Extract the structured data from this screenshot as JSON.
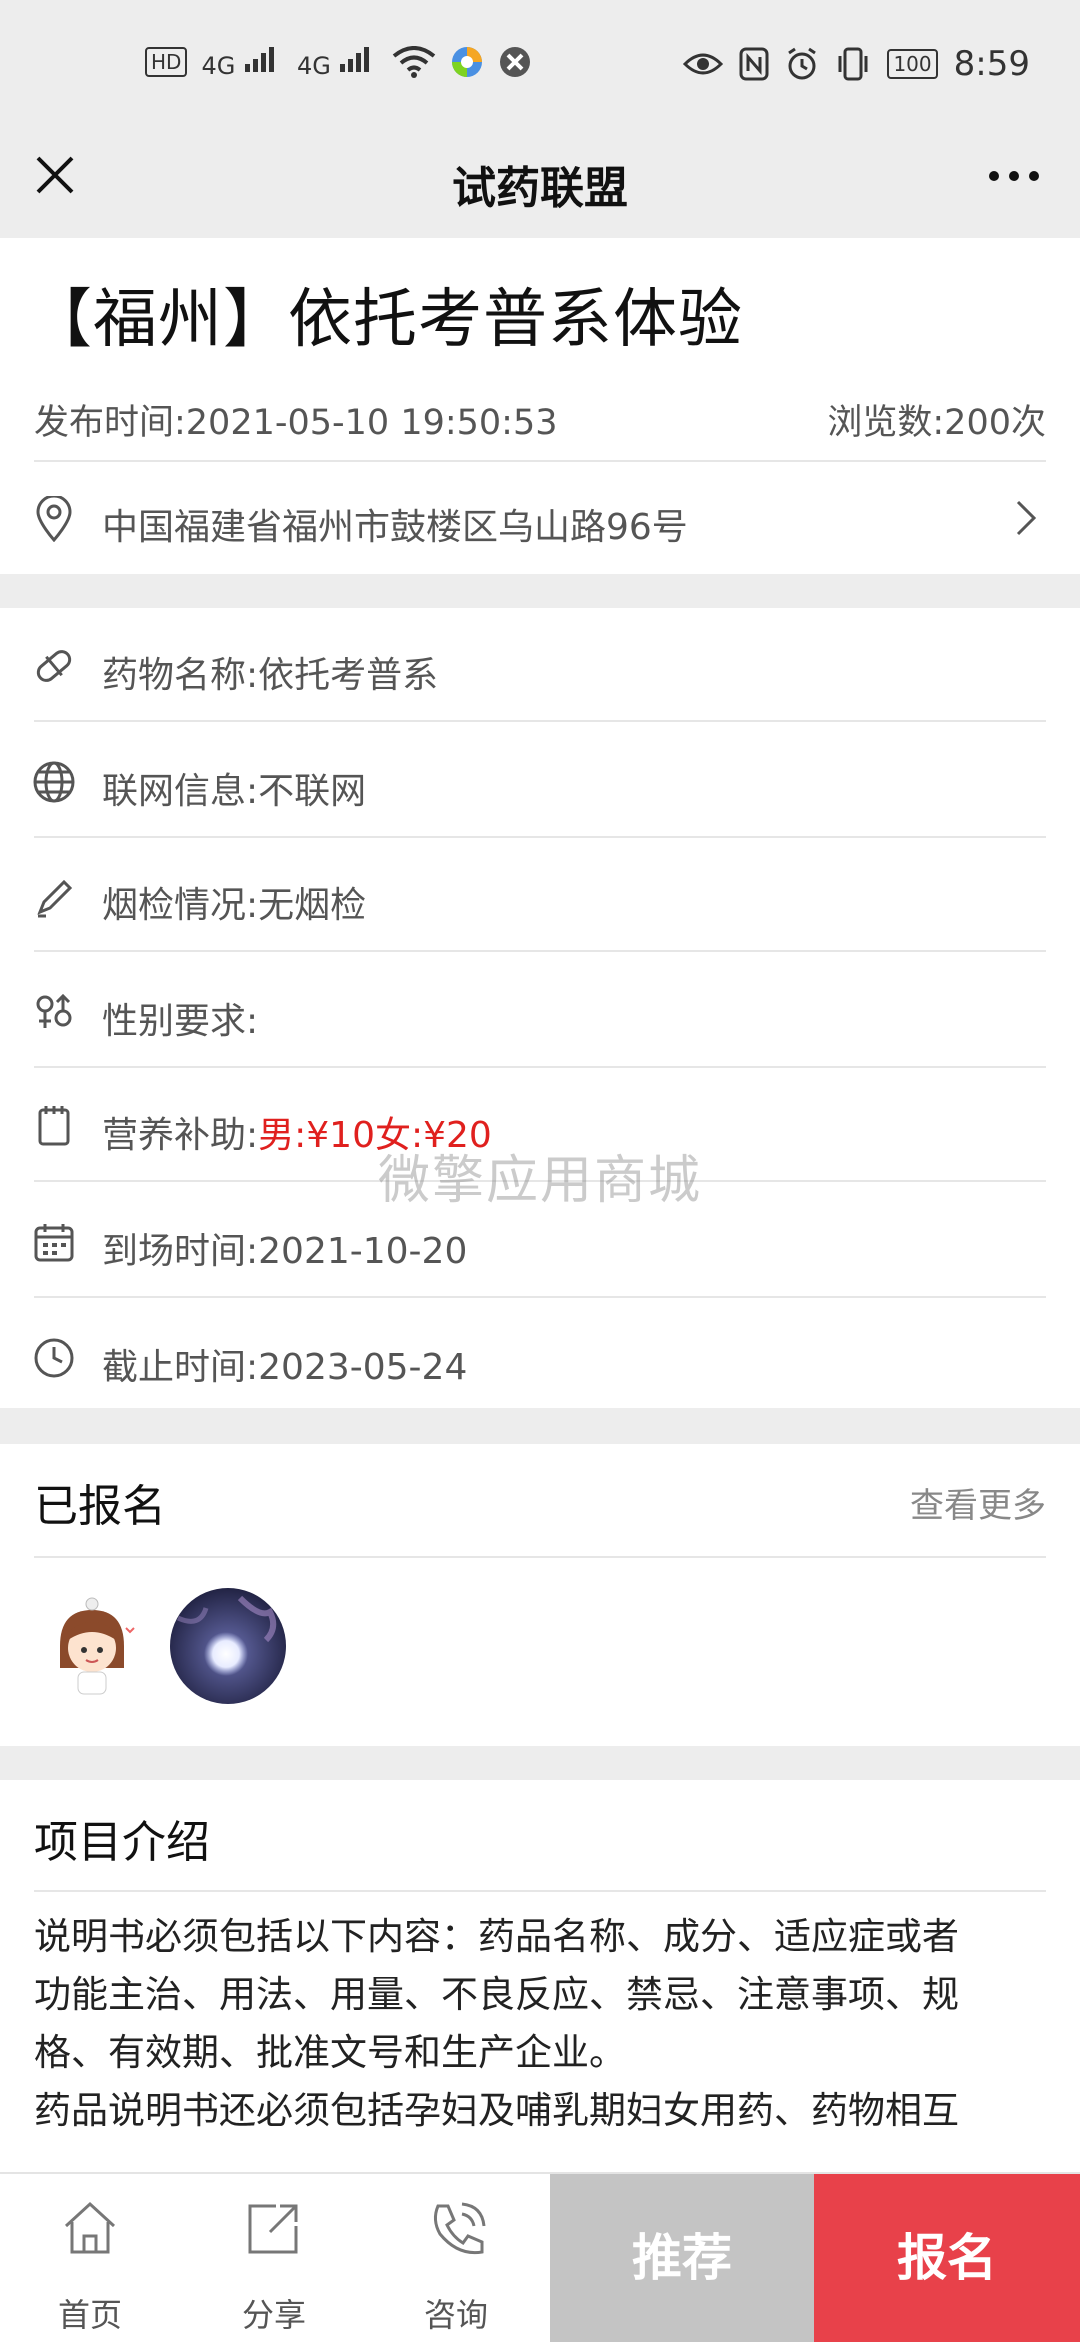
{
  "status_bar": {
    "network_left": [
      "HD",
      "4G",
      "4G"
    ],
    "battery": "100",
    "time": "8:59"
  },
  "nav": {
    "title": "试药联盟"
  },
  "trial": {
    "title": "【福州】依托考普系体验",
    "publish_time": "发布时间:2021-05-10 19:50:53",
    "views": "浏览数:200次",
    "address": "中国福建省福州市鼓楼区乌山路96号"
  },
  "details": {
    "drug_name": "药物名称:依托考普系",
    "network": "联网信息:不联网",
    "smoke_check": "烟检情况:无烟检",
    "gender": "性别要求:",
    "subsidy_label": "营养补助:",
    "subsidy_value": "男:¥10女:¥20",
    "arrival": "到场时间:2021-10-20",
    "deadline": "截止时间:2023-05-24"
  },
  "watermark": "微擎应用商城",
  "registered": {
    "title": "已报名",
    "more": "查看更多"
  },
  "intro": {
    "title": "项目介绍",
    "lines": [
      "说明书必须包括以下内容：药品名称、成分、适应症或者",
      "功能主治、用法、用量、不良反应、禁忌、注意事项、规",
      "格、有效期、批准文号和生产企业。",
      "药品说明书还必须包括孕妇及哺乳期妇女用药、药物相互"
    ]
  },
  "bottom": {
    "home": "首页",
    "share": "分享",
    "consult": "咨询",
    "recommend": "推荐",
    "signup": "报名"
  },
  "colors": {
    "accent_red": "#e0201e",
    "signup_bg": "#e8414a",
    "recommend_bg": "#c4c4c4"
  }
}
